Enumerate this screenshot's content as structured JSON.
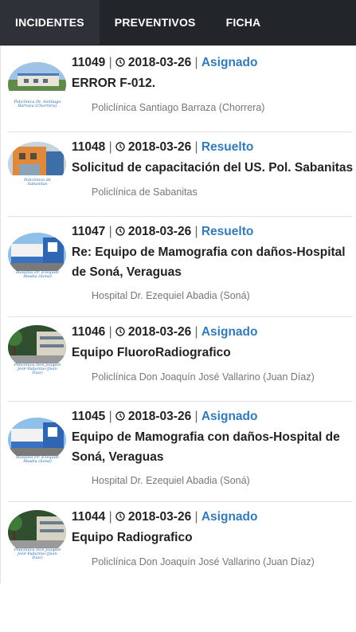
{
  "tabs": [
    {
      "label": "INCIDENTES",
      "active": true
    },
    {
      "label": "PREVENTIVOS",
      "active": false
    },
    {
      "label": "FICHA",
      "active": false
    }
  ],
  "incidents": [
    {
      "id": "11049",
      "date": "2018-03-26",
      "status": "Asignado",
      "title": "ERROR F-012.",
      "site": "Policlínica Santiago Barraza (Chorrera)",
      "thumb_caption": "Policlínica Dr. Santiago Barraza (Chorrera)",
      "thumb_icon": "clinic-photo-icon"
    },
    {
      "id": "11048",
      "date": "2018-03-26",
      "status": "Resuelto",
      "title": "Solicitud de capacitación del US. Pol. Sabanitas",
      "site": "Policlínica de Sabanitas",
      "thumb_caption": "Policlínica de Sabanitas",
      "thumb_icon": "clinic-photo-icon"
    },
    {
      "id": "11047",
      "date": "2018-03-26",
      "status": "Resuelto",
      "title": "Re: Equipo de Mamografia con daños-Hospital de Soná, Veraguas",
      "site": "Hospital Dr. Ezequiel Abadia (Soná)",
      "thumb_caption": "Hospital Dr. Ezequiel Abadia (Soná)",
      "thumb_icon": "hospital-photo-icon"
    },
    {
      "id": "11046",
      "date": "2018-03-26",
      "status": "Asignado",
      "title": "Equipo FluoroRadiografico",
      "site": "Policlínica Don Joaquín José Vallarino (Juan Díaz)",
      "thumb_caption": "Policlínica Don Joaquín José Vallarino (Juan Díaz)",
      "thumb_icon": "clinic-photo-icon"
    },
    {
      "id": "11045",
      "date": "2018-03-26",
      "status": "Asignado",
      "title": "Equipo de Mamografia con daños-Hospital de Soná, Veraguas",
      "site": "Hospital Dr. Ezequiel Abadia (Soná)",
      "thumb_caption": "Hospital Dr. Ezequiel Abadia (Soná)",
      "thumb_icon": "hospital-photo-icon"
    },
    {
      "id": "11044",
      "date": "2018-03-26",
      "status": "Asignado",
      "title": "Equipo Radiografico",
      "site": "Policlínica Don Joaquín José Vallarino (Juan Díaz)",
      "thumb_caption": "Policlínica Don Joaquín José Vallarino (Juan Díaz)",
      "thumb_icon": "clinic-photo-icon"
    }
  ],
  "colors": {
    "tabbar": "#22252a",
    "status": "#337ab7",
    "text": "#222222",
    "muted": "#777777"
  }
}
